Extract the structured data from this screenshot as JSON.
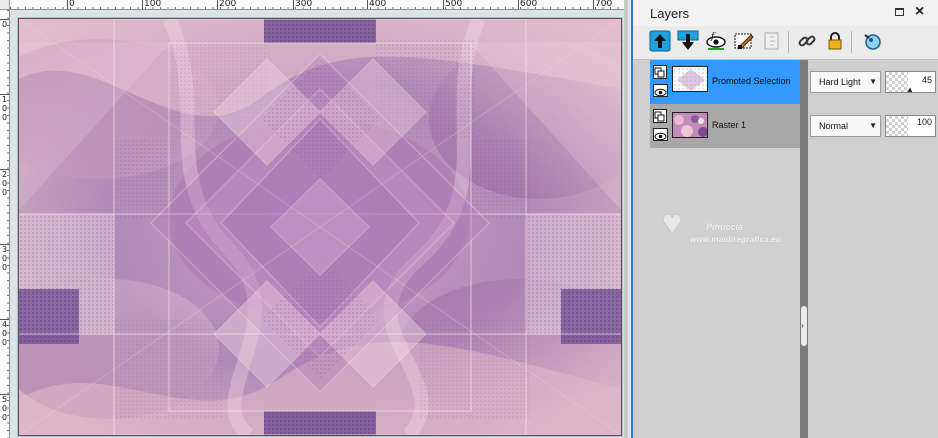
{
  "canvas": {
    "ruler_top_labels": [
      "0",
      "100",
      "200",
      "300",
      "400",
      "500",
      "600",
      "700"
    ],
    "ruler_left_labels": [
      {
        "chars": [
          "0"
        ]
      },
      {
        "chars": [
          "1",
          "0",
          "0"
        ]
      },
      {
        "chars": [
          "2",
          "0",
          "0"
        ]
      },
      {
        "chars": [
          "3",
          "0",
          "0"
        ]
      },
      {
        "chars": [
          "4",
          "0",
          "0"
        ]
      },
      {
        "chars": [
          "5",
          "0",
          "0"
        ]
      }
    ],
    "colors": {
      "base": "#b98fb3",
      "purple": "#7a4d92",
      "pink": "#e6b9c9",
      "light": "#f2dfe6",
      "dark": "#5a3a6e"
    }
  },
  "layers_panel": {
    "title": "Layers",
    "toolbar_icons": [
      "move-layer-up-icon",
      "move-layer-down-icon",
      "toggle-visibility-icon",
      "edit-selection-icon",
      "lock-transparency-icon",
      "link-layer-icon",
      "lock-layer-icon",
      "layer-style-icon"
    ],
    "layers": [
      {
        "name": "Promoted Selection",
        "blend_mode": "Hard Light",
        "opacity": "45",
        "selected": true
      },
      {
        "name": "Raster 1",
        "blend_mode": "Normal",
        "opacity": "100",
        "selected": false
      }
    ]
  },
  "watermark": {
    "line1": "Pinuccia",
    "line2": "www.maidiregrafica.eu"
  }
}
